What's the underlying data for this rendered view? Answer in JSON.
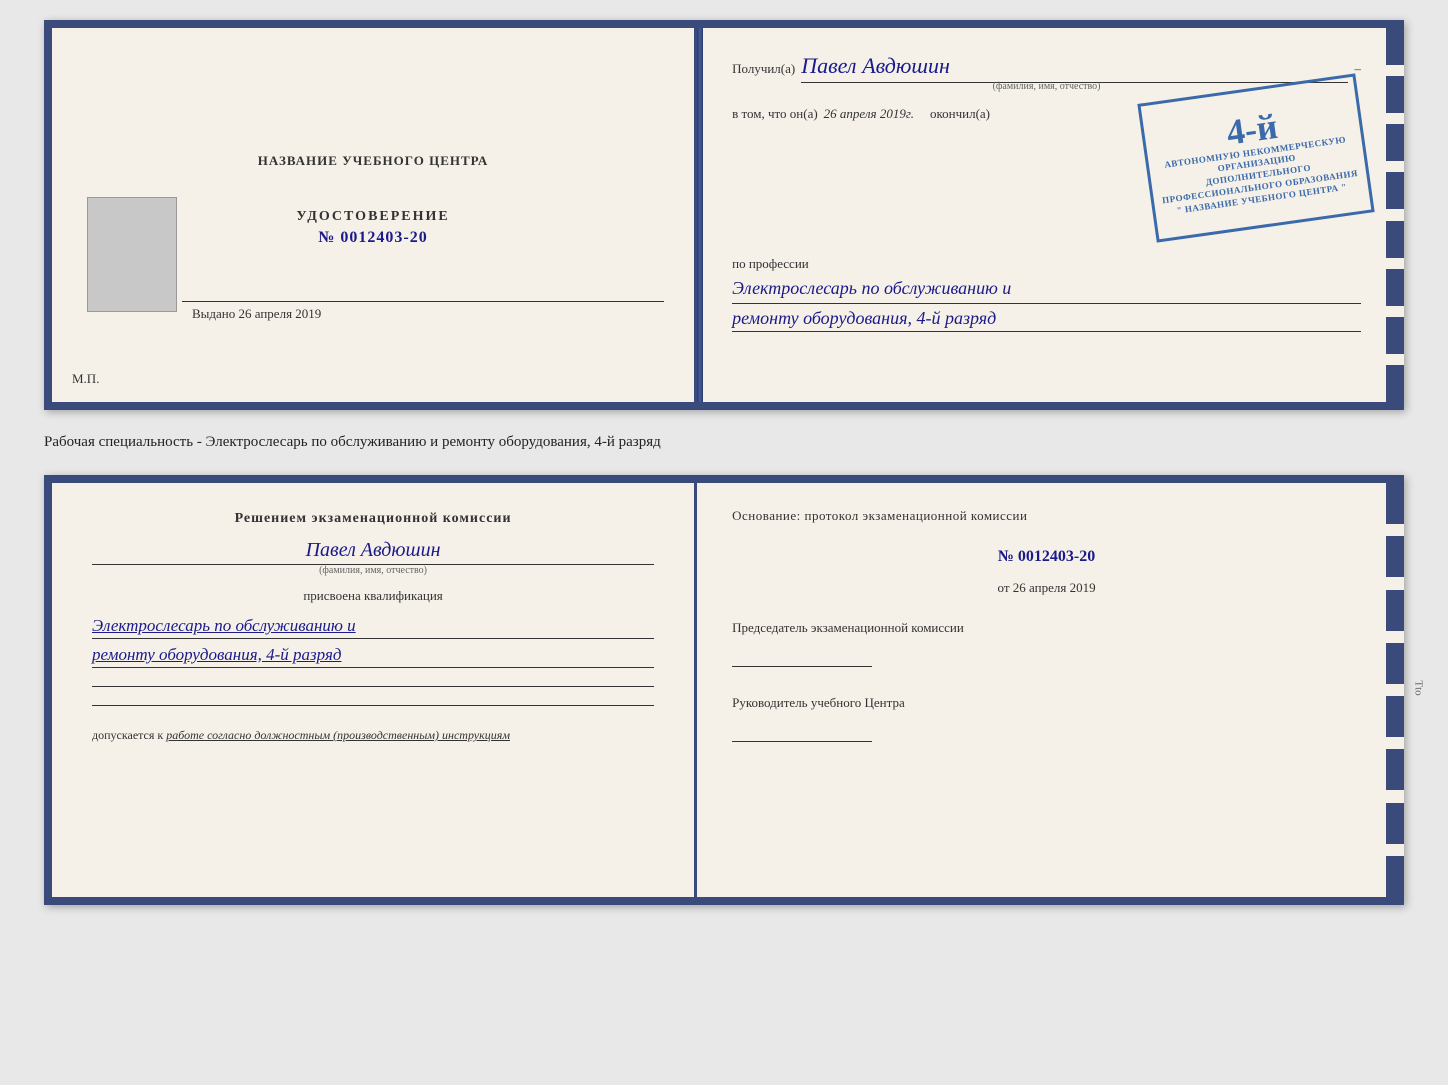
{
  "top_doc": {
    "left": {
      "title": "НАЗВАНИЕ УЧЕБНОГО ЦЕНТРА",
      "udostoverenie_label": "УДОСТОВЕРЕНИЕ",
      "udostoverenie_number": "№ 0012403-20",
      "vydano": "Выдано",
      "vydano_date": "26 апреля 2019",
      "mp": "М.П."
    },
    "right": {
      "poluchil_label": "Получил(а)",
      "person_name": "Павел Авдюшин",
      "fio_hint": "(фамилия, имя, отчество)",
      "dash": "–",
      "vtom_label": "в том, что он(а)",
      "date_value": "26 апреля 2019г.",
      "okochil_label": "окончил(а)",
      "stamp_number": "4-й",
      "stamp_line1": "АВТОНОМНУЮ НЕКОММЕРЧЕСКУЮ ОРГАНИЗАЦИЮ",
      "stamp_line2": "ДОПОЛНИТЕЛЬНОГО ПРОФЕССИОНАЛЬНОГО ОБРАЗОВАНИЯ",
      "stamp_line3": "\" НАЗВАНИЕ УЧЕБНОГО ЦЕНТРА \"",
      "professiya_label": "по профессии",
      "professiya_line1": "Электрослесарь по обслуживанию и",
      "professiya_line2": "ремонту оборудования, 4-й разряд"
    }
  },
  "separator": {
    "text": "Рабочая специальность - Электрослесарь по обслуживанию и ремонту оборудования, 4-й разряд"
  },
  "bottom_doc": {
    "left": {
      "resheniem_title": "Решением экзаменационной комиссии",
      "person_name": "Павел Авдюшин",
      "fio_hint": "(фамилия, имя, отчество)",
      "prisvoena": "присвоена квалификация",
      "kval_line1": "Электрослесарь по обслуживанию и",
      "kval_line2": "ремонту оборудования, 4-й разряд",
      "dopuskaetsya_label": "допускается к",
      "dopuskaetsya_value": "работе согласно должностным (производственным) инструкциям"
    },
    "right": {
      "osnovanie_text": "Основание: протокол экзаменационной комиссии",
      "protocol_number": "№ 0012403-20",
      "ot_label": "от",
      "ot_date": "26 апреля 2019",
      "predsedatel_label": "Председатель экзаменационной комиссии",
      "rukovoditel_label": "Руководитель учебного Центра"
    },
    "side_label": "Tto"
  }
}
